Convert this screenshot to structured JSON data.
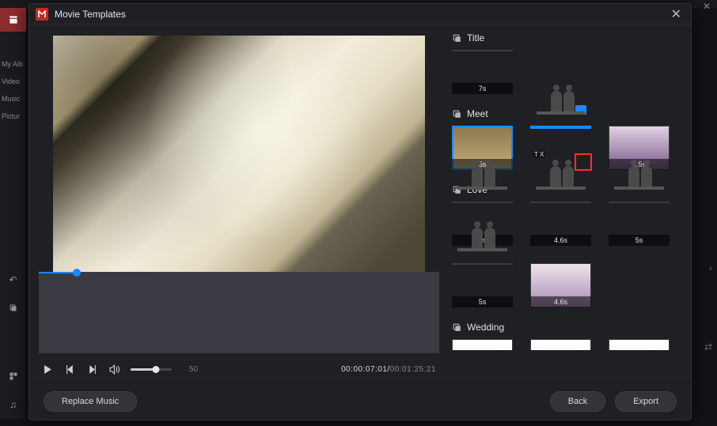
{
  "app_shell": {
    "title_fragment": "M",
    "sidebar_items": [
      "My Alb",
      "Video",
      "Music",
      "Pictur"
    ]
  },
  "modal": {
    "title": "Movie Templates",
    "preview": {
      "current_time": "00:00:07:01",
      "duration": "00:01:25:21",
      "speed": "50",
      "seek_percent": 9.5,
      "volume_percent": 62
    },
    "sections": [
      {
        "name": "Title",
        "items": [
          {
            "duration": "7s",
            "look": "th-title"
          }
        ]
      },
      {
        "name": "Meet",
        "items": [
          {
            "duration": "5s",
            "look": "th-meet0",
            "selected": true
          },
          {
            "duration": "",
            "look": "th-ph",
            "selected_outline": true,
            "red_box": true,
            "badges": [
              "T",
              "X"
            ],
            "ph_badge": true
          },
          {
            "duration": "4.5s",
            "look": "th-fl0"
          }
        ]
      },
      {
        "name": "Love",
        "items": [
          {
            "duration": "5s",
            "look": "th-ph"
          },
          {
            "duration": "4.6s",
            "look": "th-ph"
          },
          {
            "duration": "5s",
            "look": "th-ph"
          },
          {
            "duration": "5s",
            "look": "th-ph"
          },
          {
            "duration": "4.6s",
            "look": "th-fl1"
          }
        ]
      },
      {
        "name": "Wedding",
        "items": [
          {
            "duration": "",
            "look": "th-wed"
          },
          {
            "duration": "",
            "look": "th-wed"
          },
          {
            "duration": "",
            "look": "th-wed"
          }
        ],
        "truncated": true
      }
    ],
    "buttons": {
      "replace_music": "Replace Music",
      "back": "Back",
      "export": "Export"
    }
  }
}
